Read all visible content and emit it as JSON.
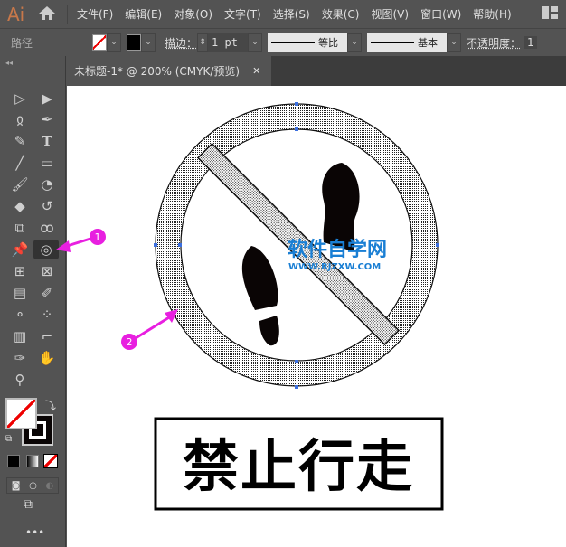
{
  "app": {
    "logo": "Ai"
  },
  "menu": [
    "文件(F)",
    "编辑(E)",
    "对象(O)",
    "文字(T)",
    "选择(S)",
    "效果(C)",
    "视图(V)",
    "窗口(W)",
    "帮助(H)"
  ],
  "control": {
    "object_type": "路径",
    "stroke_label": "描边：",
    "stroke_weight": "1 pt",
    "profile_label": "等比",
    "brush_label": "基本",
    "opacity_label": "不透明度：",
    "opacity_value": "1"
  },
  "tab": {
    "title": "未标题-1* @ 200% (CMYK/预览)",
    "close": "✕"
  },
  "artwork": {
    "sign_text": "禁止行走",
    "watermark_cn": "软件自学网",
    "watermark_url": "WWW.RJZXW.COM"
  },
  "callouts": [
    "1",
    "2"
  ],
  "colors": {
    "accent": "#e81fe0",
    "selection": "#3b6fe0",
    "watermark": "#1a7fd4"
  }
}
